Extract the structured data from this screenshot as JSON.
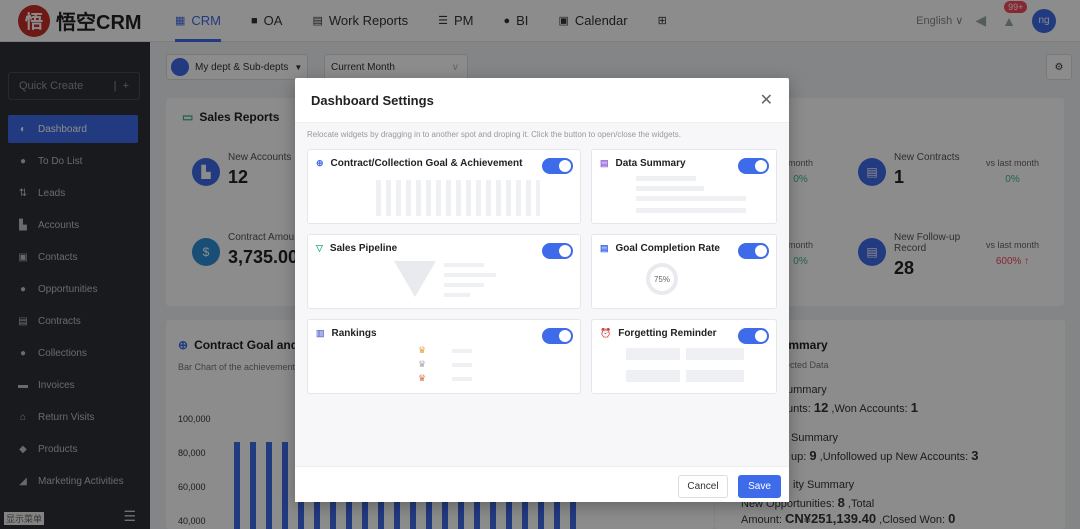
{
  "topbar": {
    "logo_mark": "悟",
    "logo_text": "悟空CRM",
    "nav": [
      {
        "label": "CRM",
        "icon": "crm-icon"
      },
      {
        "label": "OA",
        "icon": "briefcase-icon"
      },
      {
        "label": "Work Reports",
        "icon": "doc-icon"
      },
      {
        "label": "PM",
        "icon": "list-icon"
      },
      {
        "label": "BI",
        "icon": "chart-icon"
      },
      {
        "label": "Calendar",
        "icon": "calendar-icon"
      }
    ],
    "language": "English",
    "badge": "99+",
    "avatar": "ng"
  },
  "sidebar": {
    "quick_create": "Quick Create",
    "items": [
      "Dashboard",
      "To Do List",
      "Leads",
      "Accounts",
      "Contacts",
      "Opportunities",
      "Contracts",
      "Collections",
      "Invoices",
      "Return Visits",
      "Products",
      "Marketing Activities"
    ],
    "footer_label": "显示菜单"
  },
  "filters": {
    "dept": "My dept & Sub-depts",
    "period": "Current Month"
  },
  "sales_reports": {
    "title": "Sales Reports",
    "new_accounts_label": "New Accounts",
    "new_accounts_value": "12",
    "contract_amount_label": "Contract Amou",
    "contract_amount_value": "3,735.00",
    "vs1_label": "month",
    "vs1_value": "0%",
    "vs2_label": "month",
    "vs2_value": "0%",
    "new_contracts_label": "New Contracts",
    "new_contracts_value": "1",
    "vs3_label": "vs last month",
    "vs3_value": "0%",
    "followup_label": "New Follow-up Record",
    "followup_value": "28",
    "vs4_label": "vs last month",
    "vs4_value": "600% ↑"
  },
  "goal_chart": {
    "title": "Contract Goal and",
    "subtitle": "Bar Chart of the achievement"
  },
  "chart_data": {
    "type": "bar",
    "y_ticks": [
      "100,000",
      "80,000",
      "60,000",
      "40,000"
    ],
    "ylim": [
      40000,
      100000
    ]
  },
  "summary": {
    "title": "ummary",
    "subtitle": "llected Data",
    "l1": "ummary",
    "l2_pre": "unts: ",
    "l2_b1": "12",
    "l2_mid": " ,Won Accounts: ",
    "l2_b2": "1",
    "l3": "Summary",
    "l4_pre": "up: ",
    "l4_b1": "9",
    "l4_mid": " ,Unfollowed up New Accounts: ",
    "l4_b2": "3",
    "l5": "ity Summary",
    "l6_pre": "New Opportunities: ",
    "l6_b1": "8",
    "l6_mid": " ,Total",
    "l7_pre": "Amount: ",
    "l7_b1": "CN¥251,139.40",
    "l7_mid": " ,Closed Won: ",
    "l7_b2": "0"
  },
  "modal": {
    "title": "Dashboard Settings",
    "description": "Relocate widgets by dragging in to another spot and droping it. Click the button to open/close the widgets.",
    "widgets": [
      "Contract/Collection Goal & Achievement",
      "Data Summary",
      "Sales Pipeline",
      "Goal Completion Rate",
      "Rankings",
      "Forgetting Reminder"
    ],
    "gauge": "75%",
    "cancel": "Cancel",
    "save": "Save"
  }
}
